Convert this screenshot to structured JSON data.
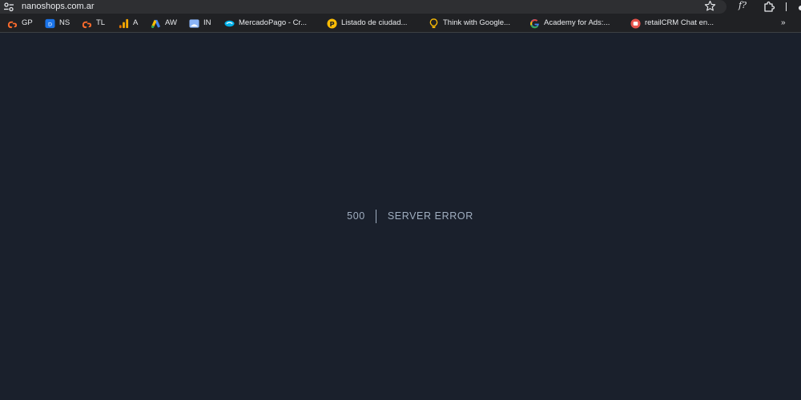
{
  "browser": {
    "url": "nanoshops.com.ar",
    "extension_label": "f?",
    "bookmarks": [
      {
        "label": "GP",
        "icon": "cpanel-icon",
        "color": "#ff6c2c"
      },
      {
        "label": "NS",
        "icon": "ns-icon",
        "color": "#1a73e8"
      },
      {
        "label": "TL",
        "icon": "cpanel-icon",
        "color": "#ff6c2c"
      },
      {
        "label": "A",
        "icon": "analytics-icon",
        "color": "#f9ab00"
      },
      {
        "label": "AW",
        "icon": "google-ads-icon",
        "color": "#4285f4"
      },
      {
        "label": "IN",
        "icon": "browser-window-icon",
        "color": "#8ab4f8"
      },
      {
        "label": "MercadoPago - Cr...",
        "icon": "mercadopago-icon",
        "color": "#00b1ea"
      },
      {
        "label": "Listado de ciudad...",
        "icon": "listado-icon",
        "color": "#fbbc04"
      },
      {
        "label": "Think with Google...",
        "icon": "lightbulb-icon",
        "color": "#fbbc04"
      },
      {
        "label": "Academy for Ads:...",
        "icon": "google-icon",
        "color": "#4285f4"
      },
      {
        "label": "retailCRM Chat en...",
        "icon": "retailcrm-icon",
        "color": "#e5534b"
      }
    ],
    "more_label": "»"
  },
  "page": {
    "code": "500",
    "message": "Server Error",
    "background_color": "#1a202c",
    "text_color": "#a0aec0"
  }
}
